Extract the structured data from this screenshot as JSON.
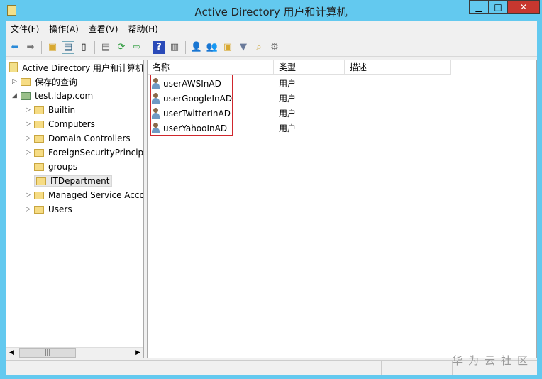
{
  "window": {
    "title": "Active Directory 用户和计算机",
    "min": "▁",
    "max": "□",
    "close": "✕"
  },
  "menu": [
    "文件(F)",
    "操作(A)",
    "查看(V)",
    "帮助(H)"
  ],
  "toolbar": [
    "back-icon",
    "forward-icon",
    "up-folder-icon",
    "show-tree-icon",
    "properties-icon",
    "export-icon",
    "refresh-icon",
    "export-list-icon",
    "help-icon",
    "console-icon",
    "new-user-icon",
    "new-group-icon",
    "new-ou-icon",
    "filter-icon",
    "find-icon",
    "delegate-icon"
  ],
  "tree": {
    "root": "Active Directory 用户和计算机",
    "saved": "保存的查询",
    "domain": "test.ldap.com",
    "children": [
      "Builtin",
      "Computers",
      "Domain Controllers",
      "ForeignSecurityPrincipals",
      "groups",
      "ITDepartment",
      "Managed Service Accounts",
      "Users"
    ],
    "selected": "ITDepartment"
  },
  "list": {
    "columns": [
      "名称",
      "类型",
      "描述"
    ],
    "rows": [
      {
        "name": "userAWSInAD",
        "type": "用户"
      },
      {
        "name": "userGoogleInAD",
        "type": "用户"
      },
      {
        "name": "userTwitterInAD",
        "type": "用户"
      },
      {
        "name": "userYahooInAD",
        "type": "用户"
      }
    ]
  },
  "watermark": "华为云社区",
  "colors": {
    "frame": "#63c9ef",
    "highlight": "#d0272d"
  }
}
